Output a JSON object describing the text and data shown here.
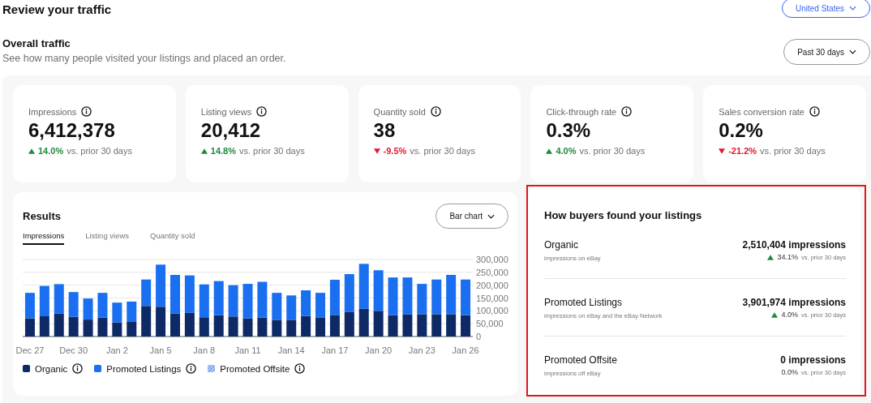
{
  "header": {
    "title": "Review your traffic",
    "region_button": "United States"
  },
  "overview": {
    "title": "Overall traffic",
    "subtitle": "See how many people visited your listings and placed an order.",
    "period_button": "Past 30 days"
  },
  "kpis": [
    {
      "label": "Impressions",
      "value": "6,412,378",
      "kind": "up",
      "change": "14.0%",
      "comparison": "vs. prior 30 days"
    },
    {
      "label": "Listing views",
      "value": "20,412",
      "kind": "up",
      "change": "14.8%",
      "comparison": "vs. prior 30 days"
    },
    {
      "label": "Quantity sold",
      "value": "38",
      "kind": "down",
      "change": "-9.5%",
      "comparison": "vs. prior 30 days"
    },
    {
      "label": "Click-through rate",
      "value": "0.3%",
      "kind": "up",
      "change": "4.0%",
      "comparison": "vs. prior 30 days"
    },
    {
      "label": "Sales conversion rate",
      "value": "0.2%",
      "kind": "down",
      "change": "-21.2%",
      "comparison": "vs. prior 30 days"
    }
  ],
  "results": {
    "title": "Results",
    "chart_type_button": "Bar chart",
    "tabs": [
      {
        "label": "Impressions",
        "selected": true
      },
      {
        "label": "Listing views",
        "selected": false
      },
      {
        "label": "Quantity sold",
        "selected": false
      }
    ],
    "chart_data": {
      "type": "bar",
      "stacked": true,
      "grid": true,
      "categories": [
        "Dec 27",
        null,
        null,
        "Dec 30",
        null,
        null,
        "Jan 2",
        null,
        null,
        "Jan 5",
        null,
        null,
        "Jan 8",
        null,
        null,
        "Jan 11",
        null,
        null,
        "Jan 14",
        null,
        null,
        "Jan 17",
        null,
        null,
        "Jan 20",
        null,
        null,
        "Jan 23",
        null,
        null,
        "Jan 26"
      ],
      "series": [
        {
          "name": "Organic",
          "color": "#0e2a66",
          "values": [
            71000,
            79000,
            90000,
            77000,
            66000,
            74000,
            55000,
            57000,
            119000,
            116000,
            90000,
            92000,
            75000,
            83000,
            78000,
            70000,
            74000,
            65000,
            65000,
            80000,
            73000,
            84000,
            95000,
            108000,
            100000,
            83000,
            87000,
            87000,
            87000,
            87000,
            83000
          ]
        },
        {
          "name": "Promoted Listings",
          "color": "#1a6ff0",
          "values": [
            99000,
            118000,
            114000,
            96000,
            82000,
            96000,
            77000,
            79000,
            103000,
            164000,
            150000,
            146000,
            128000,
            133000,
            122000,
            135000,
            139000,
            105000,
            95000,
            100000,
            97000,
            137000,
            148000,
            175000,
            158000,
            147000,
            143000,
            118000,
            135000,
            153000,
            139000
          ]
        },
        {
          "name": "Promoted Offsite",
          "color": "#7fa6ee",
          "values": [
            0,
            0,
            0,
            0,
            0,
            0,
            0,
            0,
            0,
            0,
            0,
            0,
            0,
            0,
            0,
            0,
            0,
            0,
            0,
            0,
            0,
            0,
            0,
            0,
            0,
            0,
            0,
            0,
            0,
            0,
            0
          ]
        }
      ],
      "ylim": [
        0,
        300000
      ],
      "yticks": [
        {
          "value": 0,
          "label": "0"
        },
        {
          "value": 50000,
          "label": "50,000"
        },
        {
          "value": 100000,
          "label": "100,000"
        },
        {
          "value": 150000,
          "label": "150,000"
        },
        {
          "value": 200000,
          "label": "200,000"
        },
        {
          "value": 250000,
          "label": "250,000"
        },
        {
          "value": 300000,
          "label": "300,000"
        }
      ]
    },
    "legend": [
      {
        "kind": "solid"
      },
      {
        "kind": "solid"
      },
      {
        "kind": "hatched"
      }
    ]
  },
  "sources": {
    "title": "How buyers found your listings",
    "highlighted": true,
    "rows": [
      {
        "name": "Organic",
        "description": "impressions on eBay",
        "value": "2,510,404 impressions",
        "kind": "up",
        "change": "34.1%",
        "comparison": "vs. prior 30 days"
      },
      {
        "name": "Promoted Listings",
        "description": "impressions on eBay and the eBay Network",
        "value": "3,901,974 impressions",
        "kind": "up",
        "change": "4.0%",
        "comparison": "vs. prior 30 days"
      },
      {
        "name": "Promoted Offsite",
        "description": "impressions off eBay",
        "value": "0 impressions",
        "kind": "flat",
        "change": "0.0%",
        "comparison": "vs. prior 30 days"
      }
    ]
  }
}
